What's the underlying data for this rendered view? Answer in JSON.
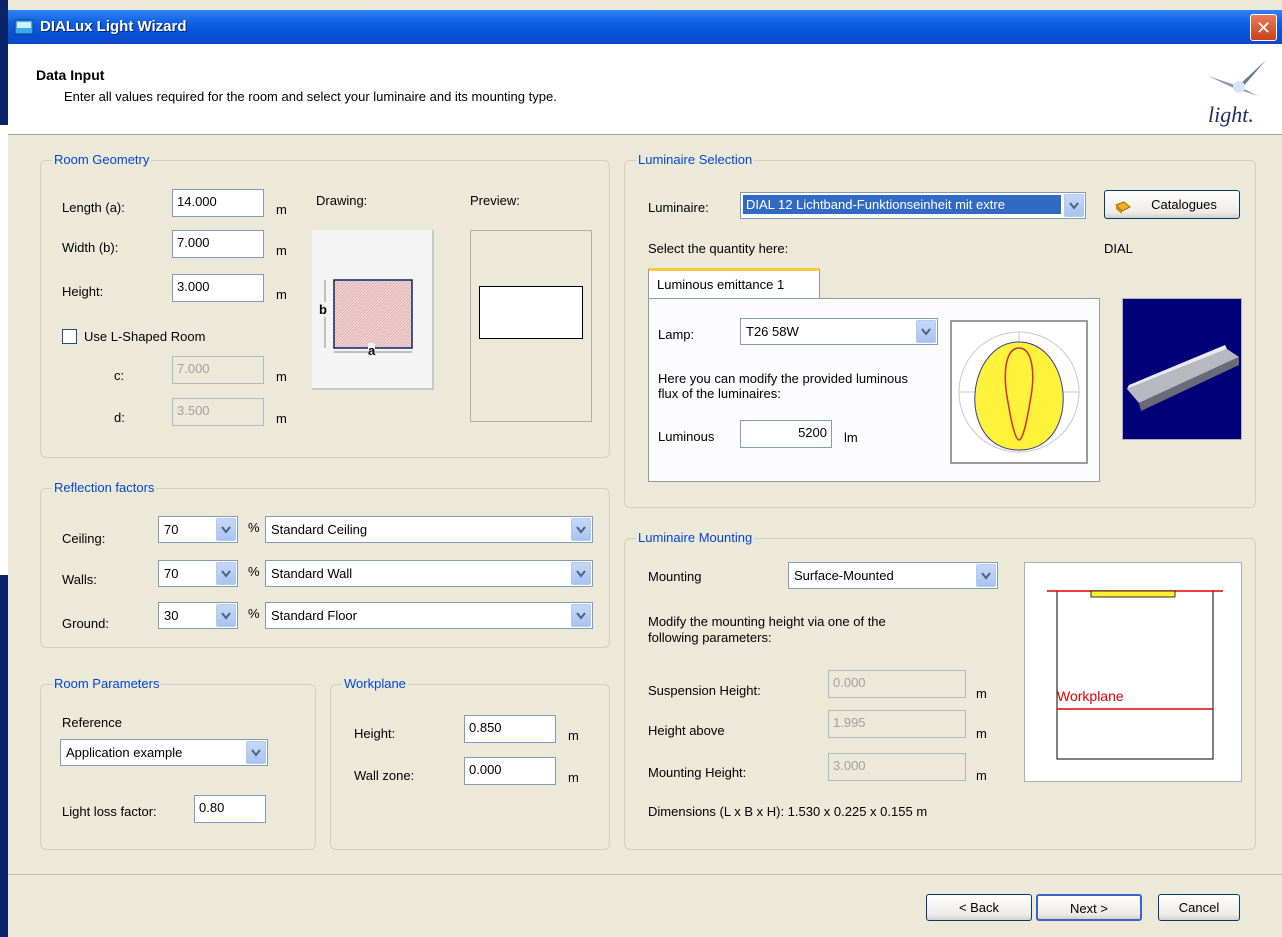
{
  "window": {
    "title": "DIALux Light Wizard",
    "close_glyph": "✕"
  },
  "header": {
    "title": "Data Input",
    "subtitle": "Enter all values required for the room and select your luminaire and its mounting type.",
    "logo_text": "light."
  },
  "room_geometry": {
    "label": "Room Geometry",
    "length_label": "Length (a):",
    "length_value": "14.000",
    "width_label": "Width (b):",
    "width_value": "7.000",
    "height_label": "Height:",
    "height_value": "3.000",
    "unit": "m",
    "drawing_label": "Drawing:",
    "preview_label": "Preview:",
    "drawing_a": "a",
    "drawing_b": "b",
    "lshape_label": "Use L-Shaped Room",
    "c_label": "c:",
    "c_value": "7.000",
    "d_label": "d:",
    "d_value": "3.500"
  },
  "reflection": {
    "label": "Reflection factors",
    "pct": "%",
    "rows": [
      {
        "label": "Ceiling:",
        "value": "70",
        "material": "Standard Ceiling"
      },
      {
        "label": "Walls:",
        "value": "70",
        "material": "Standard Wall"
      },
      {
        "label": "Ground:",
        "value": "30",
        "material": "Standard Floor"
      }
    ]
  },
  "room_params": {
    "label": "Room Parameters",
    "reference_label": "Reference",
    "reference_value": "Application example",
    "llf_label": "Light loss factor:",
    "llf_value": "0.80"
  },
  "workplane": {
    "label": "Workplane",
    "height_label": "Height:",
    "height_value": "0.850",
    "wallzone_label": "Wall zone:",
    "wallzone_value": "0.000",
    "unit": "m"
  },
  "luminaire_selection": {
    "label": "Luminaire Selection",
    "luminaire_label": "Luminaire:",
    "luminaire_value": "DIAL 12 Lichtband-Funktionseinheit mit extre",
    "catalogues_label": "Catalogues",
    "quantity_label": "Select the quantity here:",
    "manufacturer": "DIAL",
    "tab_label": "Luminous emittance 1",
    "lamp_label": "Lamp:",
    "lamp_value": "T26 58W",
    "flux_note": "Here you can modify the provided luminous flux of the luminaires:",
    "luminous_label": "Luminous",
    "luminous_value": "5200",
    "luminous_unit": "lm"
  },
  "mounting": {
    "label": "Luminaire Mounting",
    "mounting_label": "Mounting",
    "mounting_value": "Surface-Mounted",
    "note": "Modify the mounting height via one of the following parameters:",
    "suspension_label": "Suspension Height:",
    "suspension_value": "0.000",
    "above_label": "Height above",
    "above_value": "1.995",
    "mounting_height_label": "Mounting Height:",
    "mounting_height_value": "3.000",
    "unit": "m",
    "dimensions": "Dimensions (L x B x H): 1.530 x 0.225 x 0.155 m",
    "workplane_text": "Workplane"
  },
  "footer": {
    "back": "< Back",
    "next": "Next >",
    "cancel": "Cancel"
  }
}
